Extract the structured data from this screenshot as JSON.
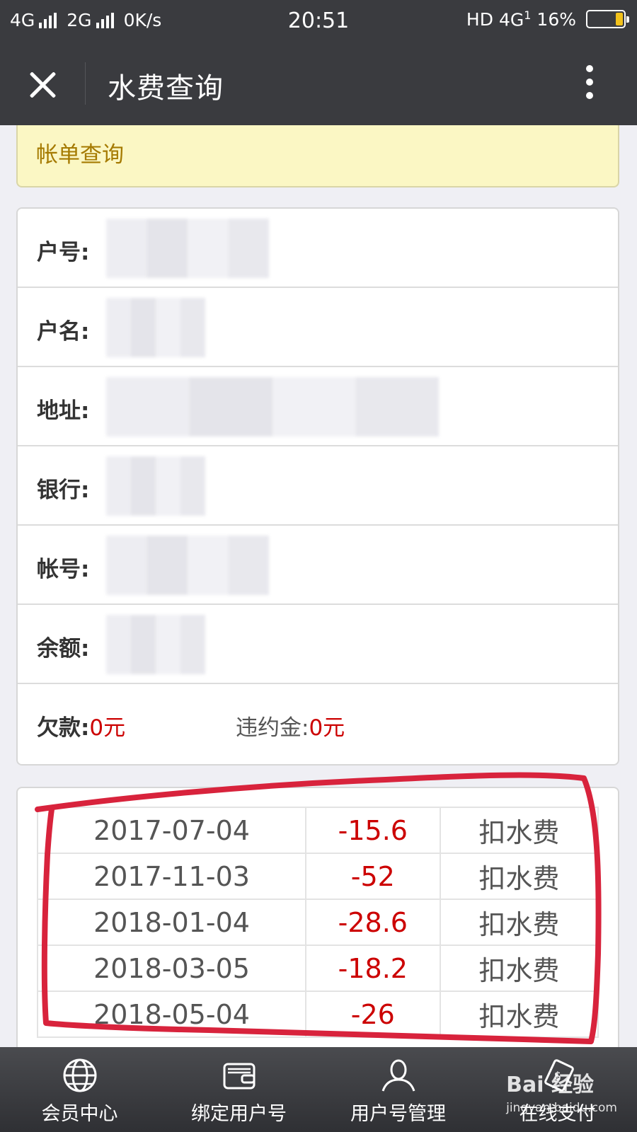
{
  "status_bar": {
    "network1": "4G",
    "network2": "2G",
    "speed": "0K/s",
    "time": "20:51",
    "hd": "HD",
    "net_right": "4G",
    "net_right_sup": "1",
    "battery": "16%"
  },
  "nav": {
    "title": "水费查询"
  },
  "banner": {
    "text": "帐单查询"
  },
  "info": {
    "rows": [
      {
        "label": "户号:"
      },
      {
        "label": "户名:"
      },
      {
        "label": "地址:"
      },
      {
        "label": "银行:"
      },
      {
        "label": "帐号:"
      },
      {
        "label": "余额:"
      }
    ],
    "debt_label": "欠款:",
    "debt_value": "0元",
    "penalty_label": "违约金:",
    "penalty_value": "0元"
  },
  "transactions": [
    {
      "date": "2017-07-04",
      "amount": "-15.6",
      "type": "扣水费"
    },
    {
      "date": "2017-11-03",
      "amount": "-52",
      "type": "扣水费"
    },
    {
      "date": "2018-01-04",
      "amount": "-28.6",
      "type": "扣水费"
    },
    {
      "date": "2018-03-05",
      "amount": "-18.2",
      "type": "扣水费"
    },
    {
      "date": "2018-05-04",
      "amount": "-26",
      "type": "扣水费"
    }
  ],
  "tabs": [
    {
      "label": "会员中心",
      "icon": "globe-icon"
    },
    {
      "label": "绑定用户号",
      "icon": "wallet-icon"
    },
    {
      "label": "用户号管理",
      "icon": "user-icon"
    },
    {
      "label": "在线支付",
      "icon": "payment-icon"
    }
  ],
  "watermark": {
    "text": "Bai 经验",
    "sub": "jingyan.baidu.com"
  },
  "colors": {
    "header_bg": "#3a3b3f",
    "banner_bg": "#fbf7c4",
    "banner_text": "#a57a00",
    "negative_amount": "#cc0000",
    "highlight_ring": "#d8233c"
  }
}
